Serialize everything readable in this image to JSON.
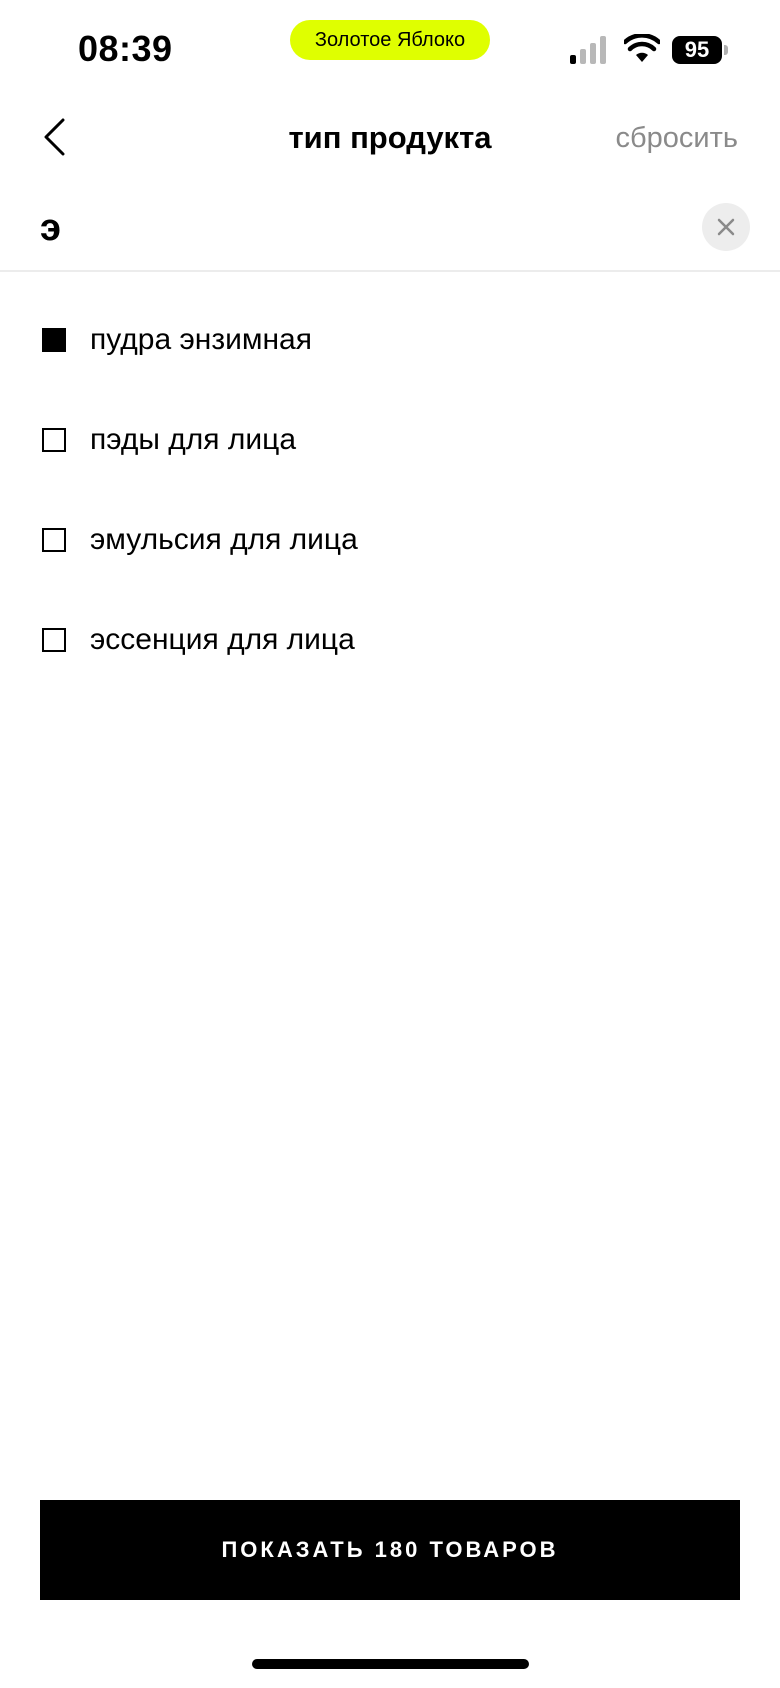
{
  "status_bar": {
    "time": "08:39",
    "carrier": "Золотое Яблоко",
    "battery": "95",
    "carrier_color": "#dfff00"
  },
  "header": {
    "title": "тип продукта",
    "reset_label": "сбросить",
    "back_icon": "chevron-left-icon"
  },
  "search": {
    "value": "э",
    "clear_icon": "close-icon"
  },
  "options": [
    {
      "label": "пудра энзимная",
      "checked": true
    },
    {
      "label": "пэды для лица",
      "checked": false
    },
    {
      "label": "эмульсия для лица",
      "checked": false
    },
    {
      "label": "эссенция для лица",
      "checked": false
    }
  ],
  "footer": {
    "show_button_label": "ПОКАЗАТЬ 180 ТОВАРОВ"
  }
}
